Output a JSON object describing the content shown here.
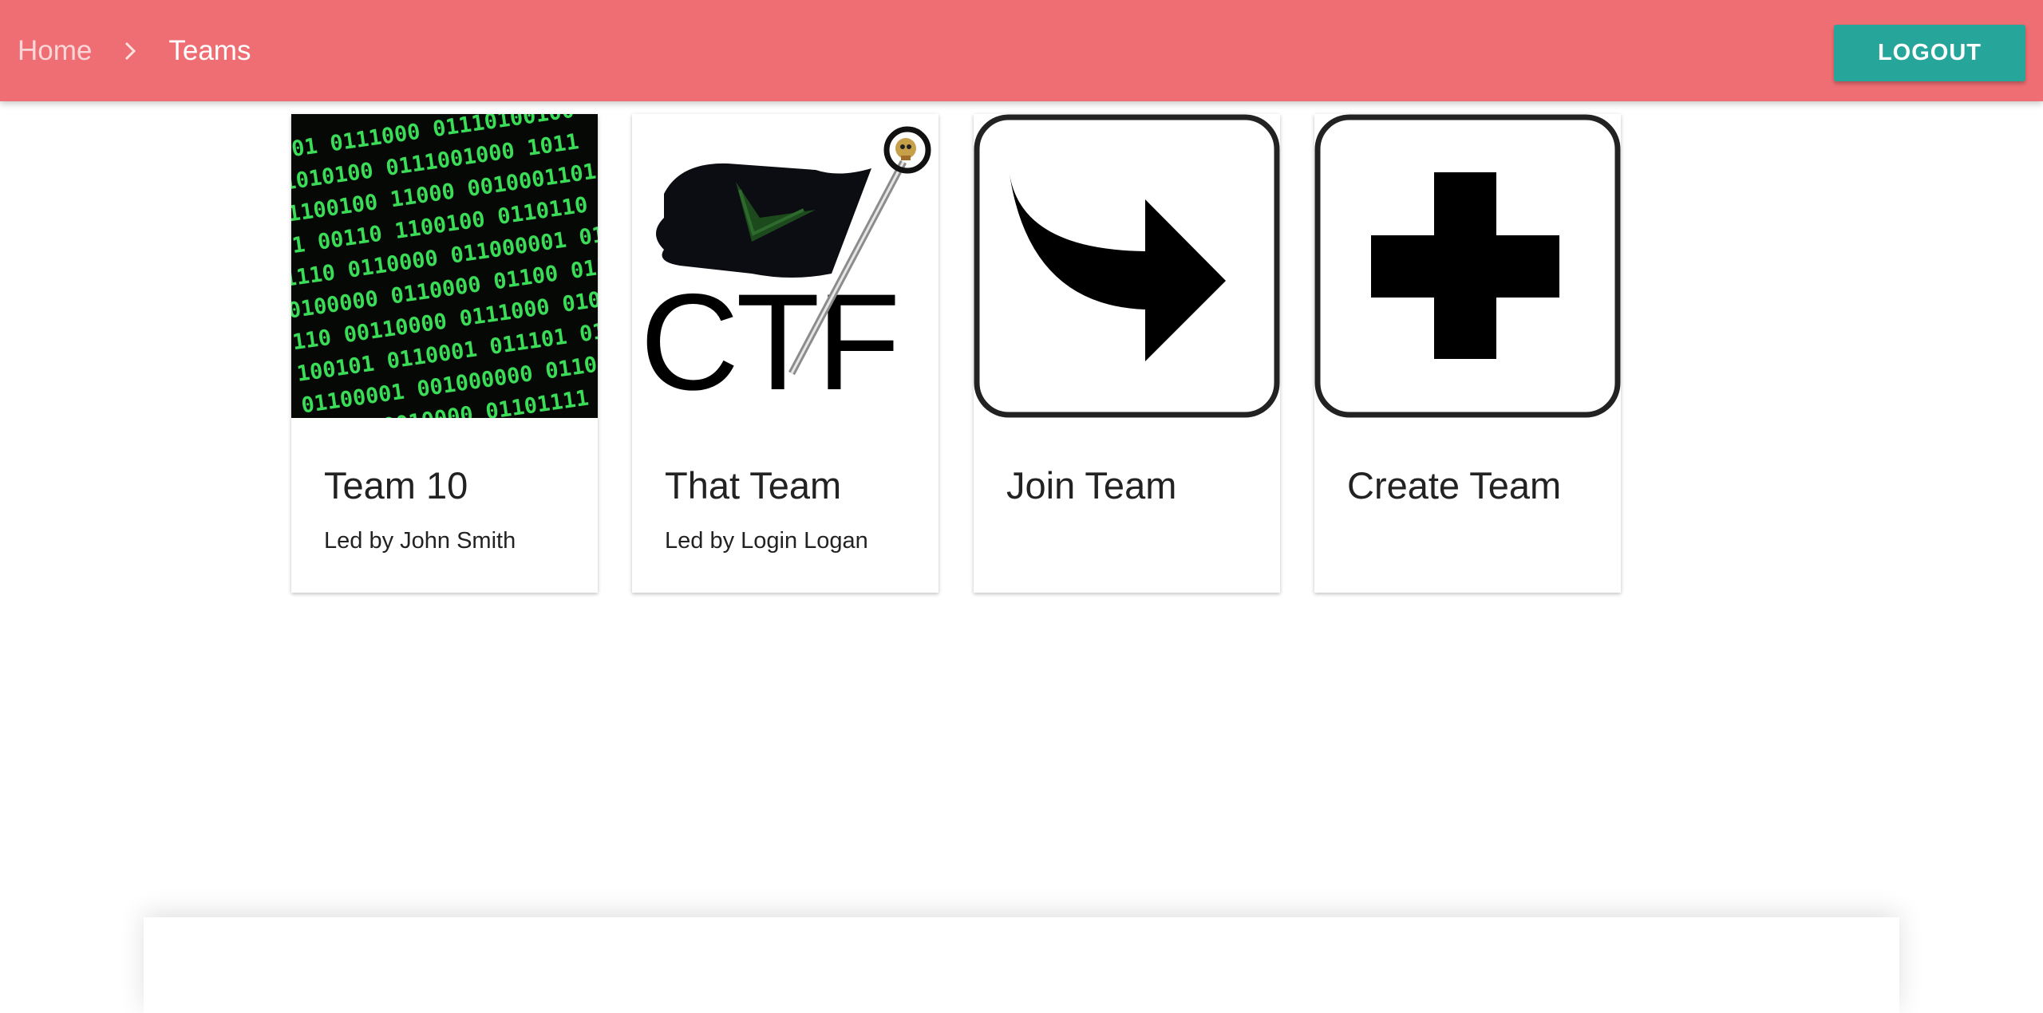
{
  "nav": {
    "breadcrumbs": [
      "Home",
      "Teams"
    ],
    "logout_label": "LOGOUT"
  },
  "cards": [
    {
      "title": "Team 10",
      "subtitle": "Led by John Smith",
      "image": "binary-code-image"
    },
    {
      "title": "That Team",
      "subtitle": "Led by Login Logan",
      "image": "ctf-flag-logo",
      "logo_text": "CTF"
    },
    {
      "title": "Join Team",
      "subtitle": "",
      "image": "curved-arrow-icon"
    },
    {
      "title": "Create Team",
      "subtitle": "",
      "image": "plus-icon"
    }
  ],
  "colors": {
    "header": "#ee6e73",
    "accent_button": "#26a69a"
  }
}
